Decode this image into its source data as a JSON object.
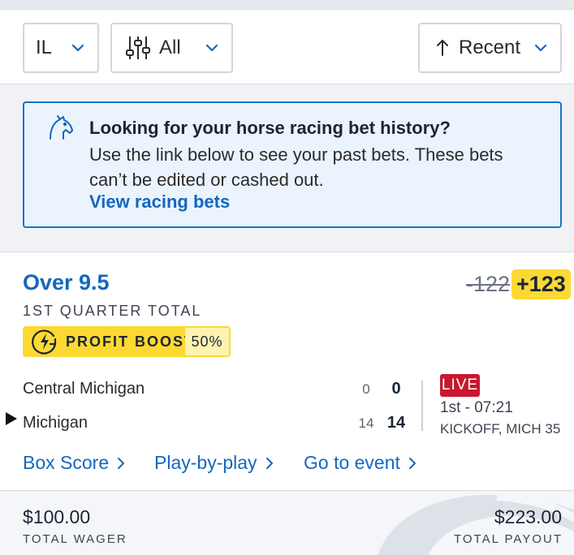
{
  "filters": {
    "state": {
      "value": "IL",
      "icon": "chevron-down-icon"
    },
    "bet_filter": {
      "value": "All",
      "icon": "sliders-icon"
    },
    "sort": {
      "value": "Recent",
      "icon": "arrow-up-icon"
    }
  },
  "racing_notice": {
    "title": "Looking for your horse racing bet history?",
    "body": "Use the link below to see your past bets. These bets can’t be edited or cashed out.",
    "link": "View racing bets",
    "icon": "horse-head-icon"
  },
  "bet": {
    "selection": "Over 9.5",
    "market": "1ST QUARTER TOTAL",
    "odds_original": "-122",
    "odds_boosted": "+123",
    "boost": {
      "label": "PROFIT BOOST",
      "percent": "50%"
    },
    "teams": [
      {
        "name": "Central Michigan",
        "quarter_score": "0",
        "total_score": "0",
        "possession": false
      },
      {
        "name": "Michigan",
        "quarter_score": "14",
        "total_score": "14",
        "possession": true
      }
    ],
    "status": {
      "badge": "LIVE",
      "clock": "1st - 07:21",
      "situation": "KICKOFF, MICH 35"
    },
    "links": {
      "box_score": "Box Score",
      "play_by_play": "Play-by-play",
      "go_to_event": "Go to event"
    }
  },
  "footer": {
    "total_wager": "$100.00",
    "total_wager_label": "TOTAL WAGER",
    "total_payout": "$223.00",
    "total_payout_label": "TOTAL PAYOUT"
  },
  "colors": {
    "accent_blue": "#1467c0",
    "boost_yellow": "#fcd932",
    "live_red": "#c8182f"
  }
}
